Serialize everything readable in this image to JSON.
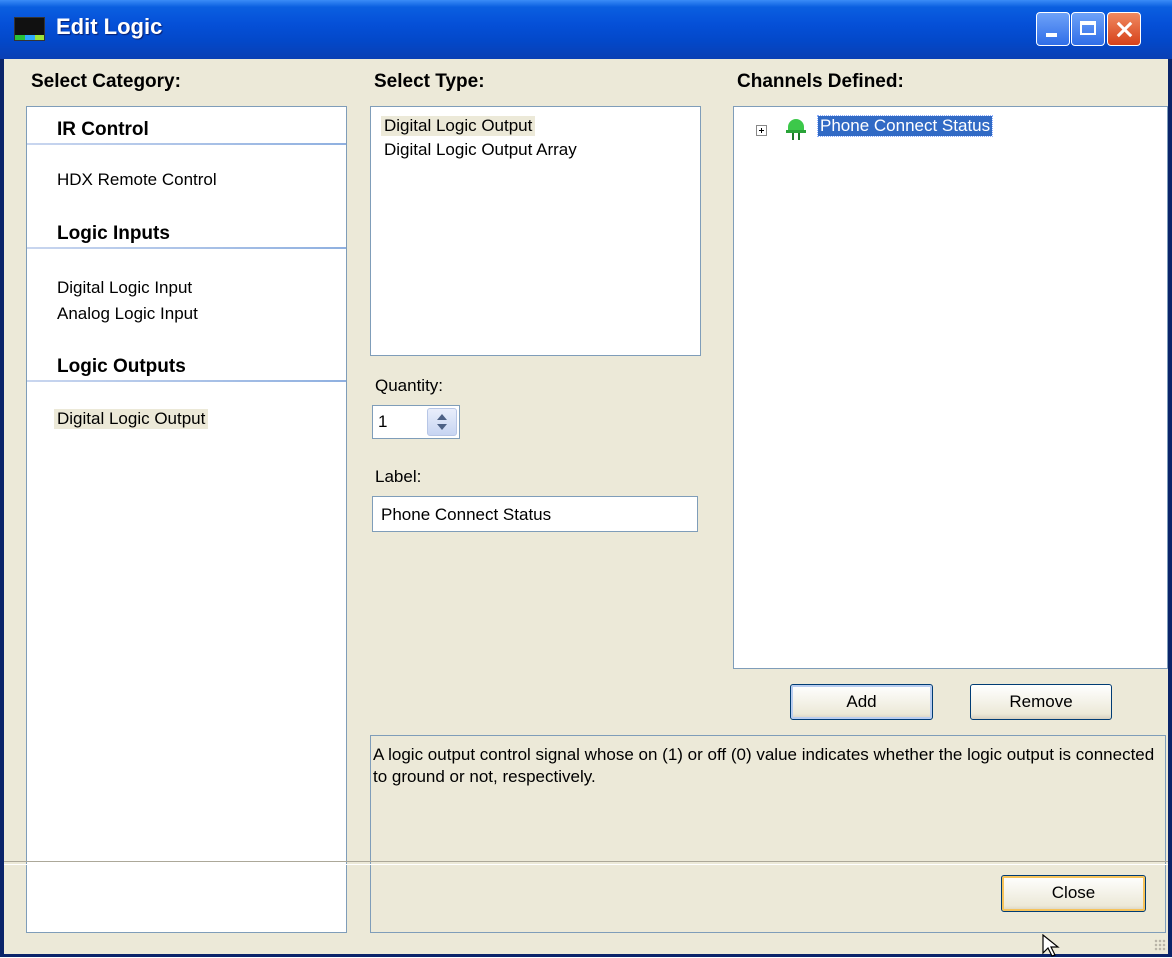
{
  "window": {
    "title": "Edit Logic",
    "titlebar_color": "#0a5fe0",
    "title_icon": "app-logic-icon",
    "controls": [
      "minimize-icon",
      "maximize-icon",
      "close-icon"
    ]
  },
  "select_category": {
    "header": "Select Category:",
    "groups": [
      {
        "title": "IR Control",
        "items": [
          "HDX Remote Control"
        ]
      },
      {
        "title": "Logic Inputs",
        "items": [
          "Digital Logic Input",
          "Analog Logic Input"
        ]
      },
      {
        "title": "Logic Outputs",
        "items": [
          "Digital Logic Output"
        ],
        "selected": "Digital Logic Output"
      }
    ]
  },
  "select_type": {
    "header": "Select Type:",
    "items": [
      "Digital Logic Output",
      "Digital Logic Output Array"
    ],
    "selected": "Digital Logic Output"
  },
  "quantity": {
    "label": "Quantity:",
    "value": "1"
  },
  "label_field": {
    "label": "Label:",
    "value": "Phone Connect Status"
  },
  "channels_defined": {
    "header": "Channels Defined:",
    "items": [
      {
        "label": "Phone Connect Status",
        "icon": "led-green-icon",
        "selected": true
      }
    ]
  },
  "buttons": {
    "add": "Add",
    "remove": "Remove",
    "close": "Close"
  },
  "description": "A logic output control signal whose on (1) or off (0) value indicates whether the logic output is connected to ground or not, respectively."
}
